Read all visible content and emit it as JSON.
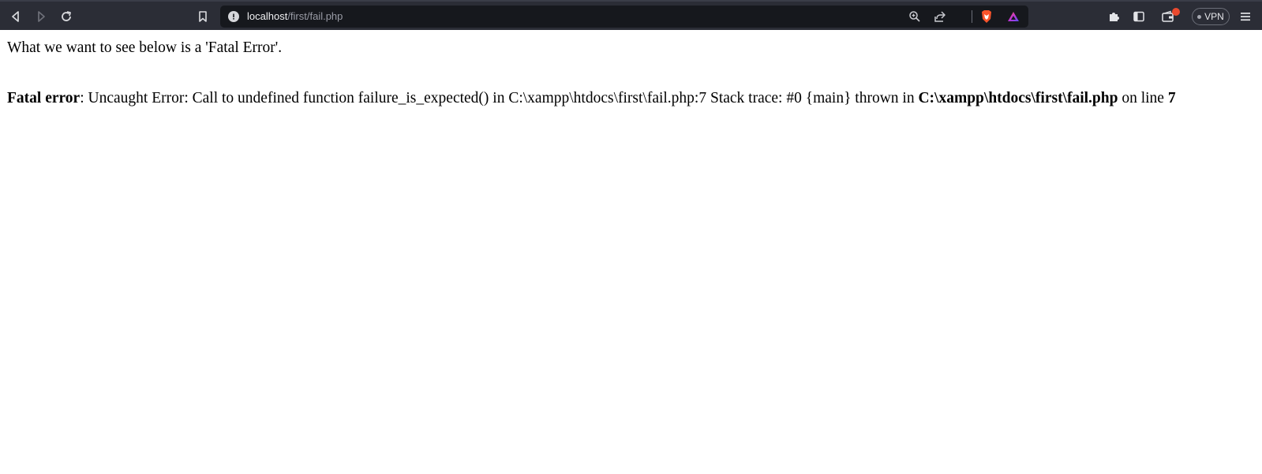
{
  "browser": {
    "url_host": "localhost",
    "url_path": "/first/fail.php",
    "vpn_label": "VPN",
    "icons": {
      "back": "back-icon",
      "forward": "forward-icon",
      "reload": "reload-icon",
      "bookmark": "bookmark-icon",
      "site_info": "info-icon",
      "zoom": "zoom-icon",
      "share": "share-icon",
      "brave": "brave-shield-icon",
      "rewards": "brave-rewards-icon",
      "extensions": "puzzle-icon",
      "sidebar": "sidebar-icon",
      "wallet": "wallet-icon",
      "menu": "hamburger-menu-icon"
    },
    "colors": {
      "toolbar": "#2b2d36",
      "urlbar": "#16181d",
      "brave_orange": "#fb542b",
      "badge": "#ea4a2f"
    }
  },
  "page": {
    "intro": "What we want to see below is a 'Fatal Error'.",
    "error": {
      "label": "Fatal error",
      "message": ": Uncaught Error: Call to undefined function failure_is_expected() in C:\\xampp\\htdocs\\first\\fail.php:7 Stack trace: #0 {main} thrown in ",
      "file": "C:\\xampp\\htdocs\\first\\fail.php",
      "on_line": " on line ",
      "line": "7"
    }
  }
}
